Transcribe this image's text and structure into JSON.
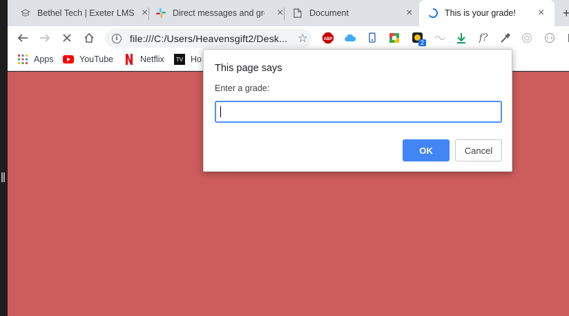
{
  "tabs": [
    {
      "title": "Bethel Tech | Exeter LMS",
      "icon": "cap-icon"
    },
    {
      "title": "Direct messages and gro",
      "icon": "slack-icon"
    },
    {
      "title": "Document",
      "icon": "document-icon"
    },
    {
      "title": "This is your grade!",
      "icon": "loading-spinner-icon",
      "active": true
    }
  ],
  "new_tab_symbol": "+",
  "toolbar": {
    "url": "file:///C:/Users/Heavensgift2/Desk...",
    "extensions": {
      "badge_count": "2",
      "adblock_label": "ABP",
      "formula_label": "f?"
    }
  },
  "bookmarks": [
    {
      "label": "Apps",
      "icon": "apps-grid-icon"
    },
    {
      "label": "YouTube",
      "icon": "youtube-icon"
    },
    {
      "label": "Netflix",
      "icon": "netflix-icon"
    },
    {
      "label": "Ho",
      "icon": "tv-icon"
    }
  ],
  "dialog": {
    "title": "This page says",
    "message": "Enter a grade:",
    "input_value": "",
    "ok_label": "OK",
    "cancel_label": "Cancel"
  },
  "colors": {
    "page_background": "#cd5c5c",
    "accent": "#4285f4"
  }
}
